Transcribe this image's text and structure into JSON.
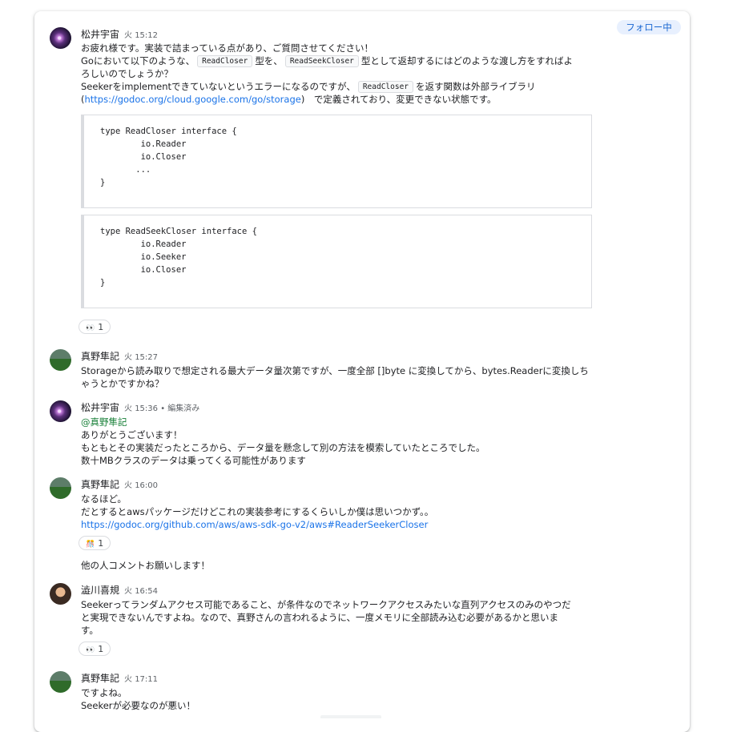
{
  "follow_label": "フォロー中",
  "messages": [
    {
      "author": "松井宇宙",
      "time": "火 15:12",
      "line1": "お疲れ様です。実装で詰まっている点があり、ご質問させてください！",
      "line2a": "Goにおいて以下のような、",
      "chip1": "ReadCloser",
      "line2b": "型を、",
      "chip2": "ReadSeekCloser",
      "line2c": "型として返却するにはどのような渡し方をすればよ",
      "line3": "ろしいのでしょうか？",
      "line4a": "Seekerをimplementできていないというエラーになるのですが、",
      "chip3": "ReadCloser",
      "line4b": "を返す関数は外部ライブラリ",
      "line5_open": "(",
      "line5_link": "https://godoc.org/cloud.google.com/go/storage",
      "line5_rest": ")　で定義されており、変更できない状態です。",
      "code1": "type ReadCloser interface {\n        io.Reader\n        io.Closer\n       ...\n}",
      "code2": "type ReadSeekCloser interface {\n        io.Reader\n        io.Seeker\n        io.Closer\n}",
      "reaction": {
        "emoji": "👀",
        "count": "1"
      }
    },
    {
      "author": "真野隼記",
      "time": "火 15:27",
      "line1": "Storageから読み取りで想定される最大データ量次第ですが、一度全部 []byte に変換してから、bytes.Readerに変換しち",
      "line2": "ゃうとかですかね？"
    },
    {
      "author": "松井宇宙",
      "time": "火 15:36",
      "edited": " • 編集済み",
      "mention": "@真野隼記",
      "line1": "ありがとうございます！",
      "line2": "もともとその実装だったところから、データ量を懸念して別の方法を模索していたところでした。",
      "line3": "数十MBクラスのデータは乗ってくる可能性があります"
    },
    {
      "author": "真野隼記",
      "time": "火 16:00",
      "line1": "なるほど。",
      "line2": "だとするとawsパッケージだけどこれの実装参考にするくらいしか僕は思いつかず。。",
      "link": "https://godoc.org/github.com/aws/aws-sdk-go-v2/aws#ReaderSeekerCloser",
      "reaction": {
        "emoji": "🎊",
        "count": "1"
      },
      "line3": "他の人コメントお願いします！"
    },
    {
      "author": "澁川喜規",
      "time": "火 16:54",
      "line1": "Seekerってランダムアクセス可能であること、が条件なのでネットワークアクセスみたいな直列アクセスのみのやつだ",
      "line2": "と実現できないんですよね。なので、真野さんの言われるように、一度メモリに全部読み込む必要があるかと思いま",
      "line3": "す。",
      "reaction": {
        "emoji": "👀",
        "count": "1"
      }
    },
    {
      "author": "真野隼記",
      "time": "火 17:11",
      "line1": "ですよね。",
      "line2": "Seekerが必要なのが悪い！"
    }
  ]
}
